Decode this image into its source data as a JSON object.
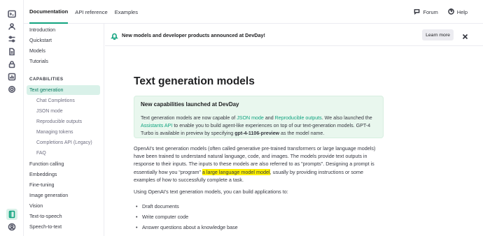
{
  "topnav": {
    "tabs": [
      "Documentation",
      "API reference",
      "Examples"
    ],
    "forum": "Forum",
    "help": "Help"
  },
  "rail": {
    "icons": [
      "terminal-icon",
      "user-group-icon",
      "sliders-icon",
      "document-icon",
      "lock-icon",
      "bar-chart-icon",
      "gear-icon",
      "book-icon",
      "account-icon"
    ]
  },
  "sidebar": {
    "items_top": [
      "Introduction",
      "Quickstart",
      "Models",
      "Tutorials"
    ],
    "section_header": "CAPABILITIES",
    "active": "Text generation",
    "sub_items": [
      "Chat Completions",
      "JSON mode",
      "Reproducible outputs",
      "Managing tokens",
      "Completions API (Legacy)",
      "FAQ"
    ],
    "items_bottom": [
      "Function calling",
      "Embeddings",
      "Fine-tuning",
      "Image generation",
      "Vision",
      "Text-to-speech",
      "Speech-to-text"
    ]
  },
  "banner": {
    "text": "New models and developer products announced at DevDay!",
    "learn_more": "Learn more"
  },
  "main": {
    "title": "Text generation models",
    "callout": {
      "title": "New capabilities launched at DevDay",
      "t1": "Text generation models are now capable of ",
      "link1": "JSON mode",
      "t2": " and ",
      "link2": "Reproducible outputs",
      "t3": ". We also launched the ",
      "link3": "Assistants API",
      "t4": " to enable you to build agent-like experiences on top of our text-generation models. GPT-4 Turbo is available in preview by specifying ",
      "model": "gpt-4-1106-preview",
      "t5": " as the model name."
    },
    "para1_a": "OpenAI's text generation models (often called generative pre-trained transformers or large language models) have been trained to understand natural language, code, and images. The models provide text outputs in response to their inputs. The inputs to these models are also referred to as \"prompts\". Designing a prompt is essentially how you “program” ",
    "para1_hl": "a large language model model",
    "para1_b": ", usually by providing instructions or some examples of how to successfully complete a task.",
    "para2": "Using OpenAI's text generation models, you can build applications to:",
    "bullets": [
      "Draft documents",
      "Write computer code",
      "Answer questions about a knowledge base"
    ]
  }
}
